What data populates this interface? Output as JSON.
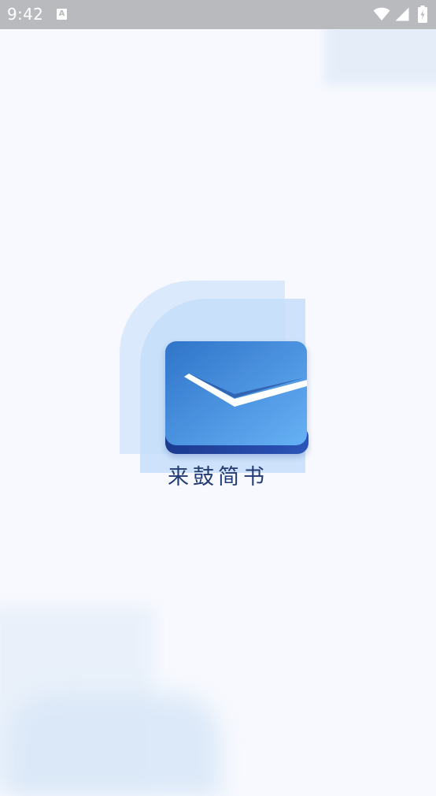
{
  "status_bar": {
    "time": "9:42",
    "notification_badge": "A",
    "icons": [
      "wifi-icon",
      "signal-icon",
      "battery-charging-icon"
    ]
  },
  "splash": {
    "app_name": "来鼓简书",
    "logo_icon": "mail-envelope-icon"
  },
  "colors": {
    "status_bar_bg": "#b9babd",
    "page_bg": "#f7f9fe",
    "logo_back_layer": "#d6e7fb",
    "logo_mid_layer": "#c3ddfa",
    "envelope_top": "#2f74c9",
    "envelope_bottom": "#67b1f5",
    "envelope_base": "#1f3f9a",
    "app_name_text": "#223b75"
  }
}
